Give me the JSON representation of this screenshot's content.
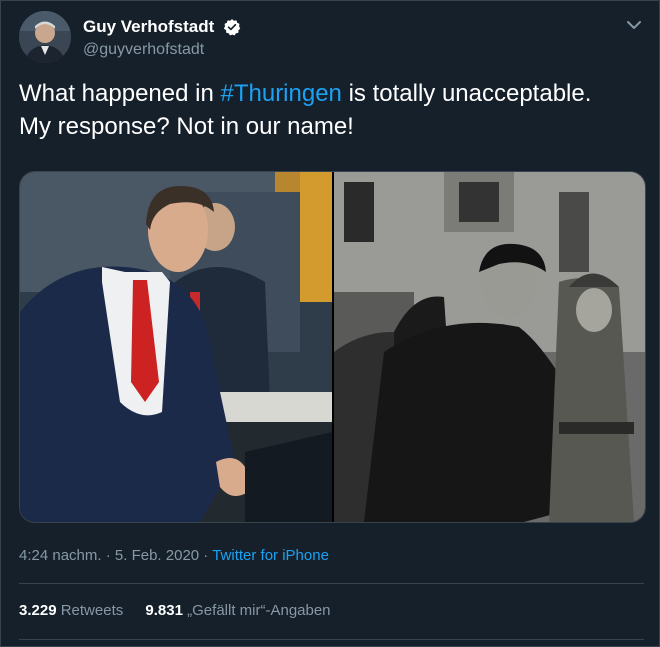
{
  "author": {
    "display_name": "Guy Verhofstadt",
    "handle": "@guyverhofstadt",
    "verified": true
  },
  "tweet": {
    "text_before": "What happened in ",
    "hashtag": "#Thuringen",
    "text_after": " is totally unacceptable.",
    "line2": "My response? Not in our name!"
  },
  "meta": {
    "time": "4:24 nachm.",
    "separator1": " · ",
    "date": "5. Feb. 2020",
    "separator2": " · ",
    "source": "Twitter for iPhone"
  },
  "stats": {
    "retweets_count": "3.229",
    "retweets_label": "Retweets",
    "likes_count": "9.831",
    "likes_label": "„Gefällt mir“-Angaben"
  },
  "colors": {
    "background": "#15202b",
    "link": "#1da1f2",
    "secondary_text": "#8899a6",
    "border": "#38444d"
  },
  "icons": [
    "verified-badge-icon",
    "chevron-down-icon"
  ]
}
